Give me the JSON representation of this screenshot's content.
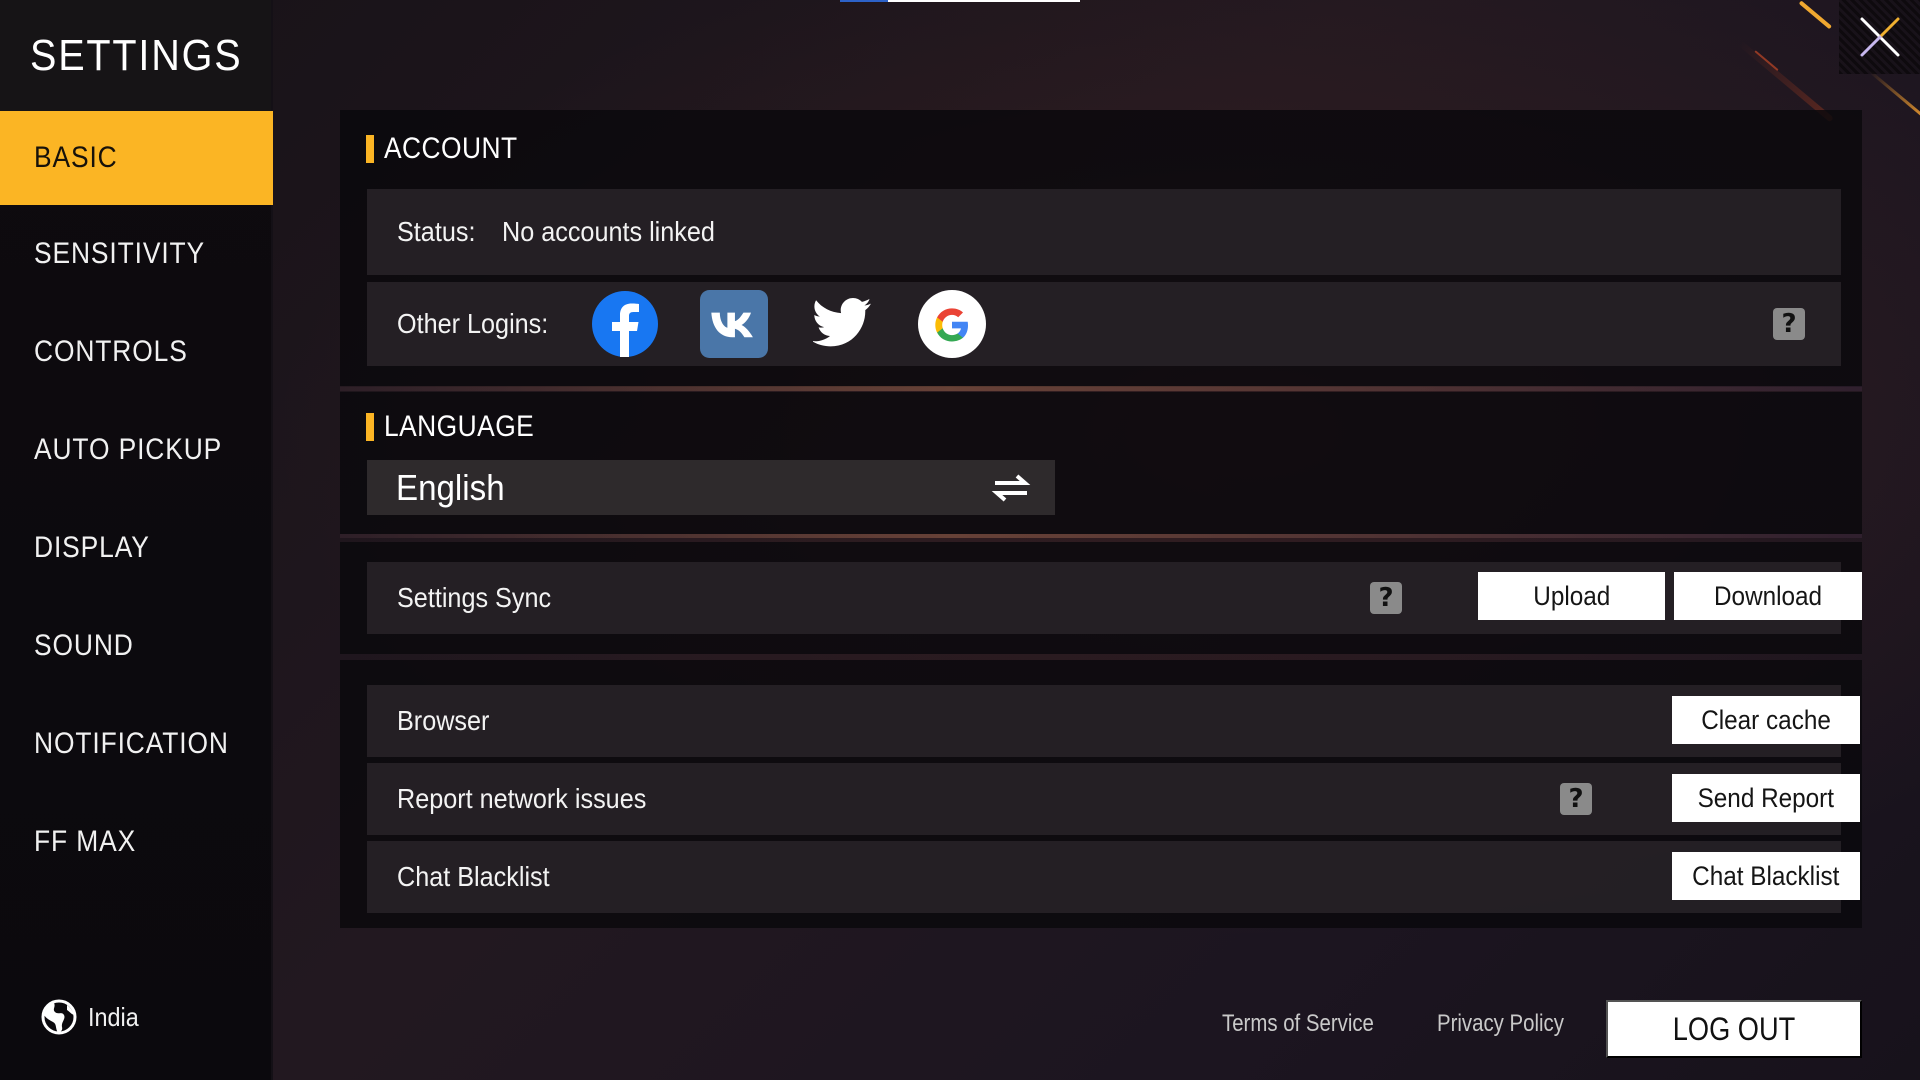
{
  "top_indicator": {
    "colors": {
      "segment_a": "#2d62c8",
      "segment_b": "#ffffff"
    }
  },
  "close_button": {
    "icon": "close-icon"
  },
  "sidebar": {
    "title": "SETTINGS",
    "active_index": 0,
    "accent_color": "#fbb524",
    "items": [
      {
        "label": "BASIC"
      },
      {
        "label": "SENSITIVITY"
      },
      {
        "label": "CONTROLS"
      },
      {
        "label": "AUTO PICKUP"
      },
      {
        "label": "DISPLAY"
      },
      {
        "label": "SOUND"
      },
      {
        "label": "NOTIFICATION"
      },
      {
        "label": "FF MAX"
      }
    ],
    "region": {
      "icon": "globe-icon",
      "label": "India"
    }
  },
  "account": {
    "title": "ACCOUNT",
    "status_label": "Status:",
    "status_value": "No accounts linked",
    "other_logins_label": "Other Logins:",
    "logins": [
      {
        "name": "Facebook",
        "icon": "facebook-icon",
        "color": "#1877f2"
      },
      {
        "name": "VK",
        "icon": "vk-icon",
        "color": "#4a76a8"
      },
      {
        "name": "Twitter",
        "icon": "twitter-icon",
        "color": "#ffffff"
      },
      {
        "name": "Google",
        "icon": "google-icon",
        "color": "#ffffff"
      }
    ],
    "help": "?"
  },
  "language": {
    "title": "LANGUAGE",
    "selected": "English",
    "switch_icon": "swap-arrows-icon"
  },
  "settings_sync": {
    "label": "Settings Sync",
    "help": "?",
    "upload_label": "Upload",
    "download_label": "Download"
  },
  "misc": {
    "browser": {
      "label": "Browser",
      "button": "Clear cache"
    },
    "report": {
      "label": "Report network issues",
      "help": "?",
      "button": "Send Report"
    },
    "blacklist": {
      "label": "Chat Blacklist",
      "button": "Chat Blacklist"
    }
  },
  "footer": {
    "terms": "Terms of Service",
    "privacy": "Privacy Policy",
    "logout": "LOG OUT"
  }
}
